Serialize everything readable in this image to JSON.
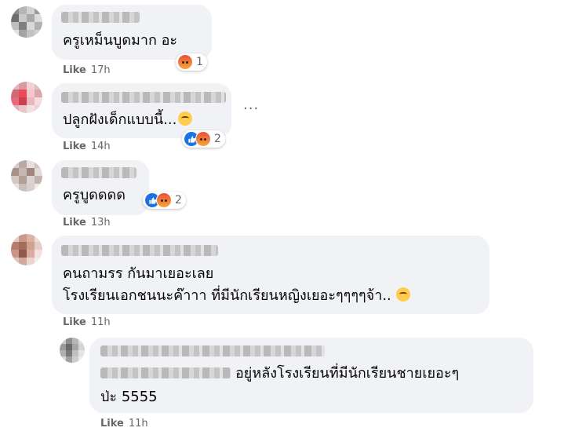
{
  "comments": [
    {
      "lines": [
        "ครูเหม็นบูดมาก อะ"
      ],
      "like_label": "Like",
      "time": "17h",
      "reactions": {
        "types": [
          "angry"
        ],
        "count": "1"
      }
    },
    {
      "lines": [
        "ปลูกฝังเด็กแบบนี้..."
      ],
      "like_label": "Like",
      "time": "14h",
      "reactions": {
        "types": [
          "like",
          "angry"
        ],
        "count": "2"
      },
      "options_label": "···"
    },
    {
      "lines": [
        "ครูบูดดดด"
      ],
      "like_label": "Like",
      "time": "13h",
      "reactions": {
        "types": [
          "like",
          "angry"
        ],
        "count": "2"
      }
    },
    {
      "lines": [
        "คนถามรร กันมาเยอะเลย",
        "โรงเรียนเอกชนนะค๊าาา ที่มีนักเรียนหญิงเยอะๆๆๆๆจ้า.."
      ],
      "like_label": "Like",
      "time": "11h"
    }
  ],
  "reply": {
    "lines": [
      "อยู่หลังโรงเรียนที่มีนักเรียนชายเยอะๆ",
      "ป่ะ 5555"
    ],
    "like_label": "Like",
    "time": "11h"
  },
  "colors": {
    "bubble": "#f0f2f5",
    "meta_text": "#65676b",
    "like_blue": "#1b74e4",
    "angry_top": "#e8503a",
    "angry_bottom": "#f6a63a"
  },
  "icons": {
    "angry_reaction": "angry-reaction-icon",
    "like_reaction": "like-reaction-icon",
    "rolling_eyes_emoji": "rolling-eyes-emoji-icon"
  }
}
